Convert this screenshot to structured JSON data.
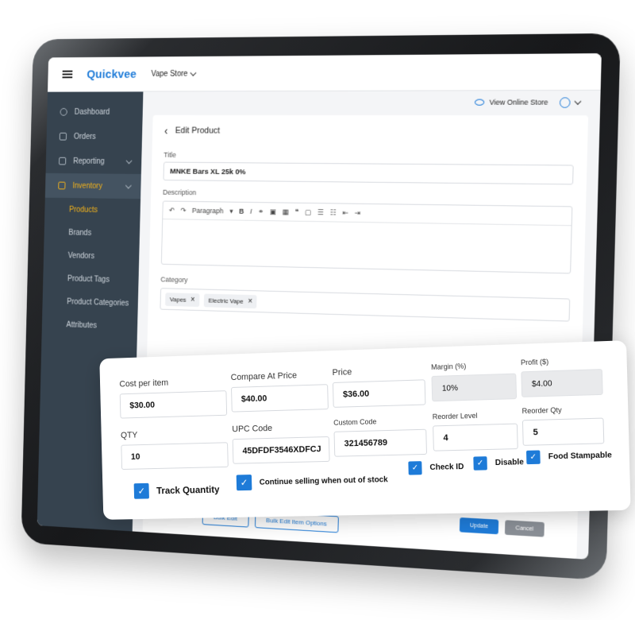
{
  "header": {
    "logo": "Quickvee",
    "store": "Vape Store"
  },
  "sidebar": {
    "items": [
      {
        "label": "Dashboard"
      },
      {
        "label": "Orders"
      },
      {
        "label": "Reporting"
      },
      {
        "label": "Inventory"
      }
    ],
    "sub_items": [
      {
        "label": "Products"
      },
      {
        "label": "Brands"
      },
      {
        "label": "Vendors"
      },
      {
        "label": "Product Tags"
      },
      {
        "label": "Product Categories"
      },
      {
        "label": "Attributes"
      }
    ]
  },
  "topright": {
    "view_store": "View Online Store"
  },
  "page": {
    "title": "Edit Product",
    "title_label": "Title",
    "title_value": "MNKE Bars XL 25k 0%",
    "description_label": "Description",
    "editor_paragraph": "Paragraph",
    "category_label": "Category",
    "categories": [
      "Vapes",
      "Electric Vape"
    ],
    "bulk_edit": "Bulk Edit",
    "bulk_edit_item_options": "Bulk Edit Item Options",
    "update": "Update",
    "cancel": "Cancel"
  },
  "panel": {
    "cost_label": "Cost per item",
    "cost_value": "$30.00",
    "compare_label": "Compare At Price",
    "compare_value": "$40.00",
    "price_label": "Price",
    "price_value": "$36.00",
    "margin_label": "Margin (%)",
    "margin_value": "10%",
    "profit_label": "Profit ($)",
    "profit_value": "$4.00",
    "qty_label": "QTY",
    "qty_value": "10",
    "upc_label": "UPC Code",
    "upc_value": "45DFDF3546XDFCJ",
    "custom_label": "Custom Code",
    "custom_value": "321456789",
    "reorder_level_label": "Reorder Level",
    "reorder_level_value": "4",
    "reorder_qty_label": "Reorder Qty",
    "reorder_qty_value": "5",
    "checks": {
      "track_quantity": "Track Quantity",
      "continue_selling": "Continue selling when out of stock",
      "check_id": "Check ID",
      "disable": "Disable",
      "food_stampable": "Food Stampable"
    }
  },
  "colors": {
    "accent": "#1e7bd8",
    "sidebar": "#36434f",
    "sidebar_active": "#f2b21b"
  }
}
